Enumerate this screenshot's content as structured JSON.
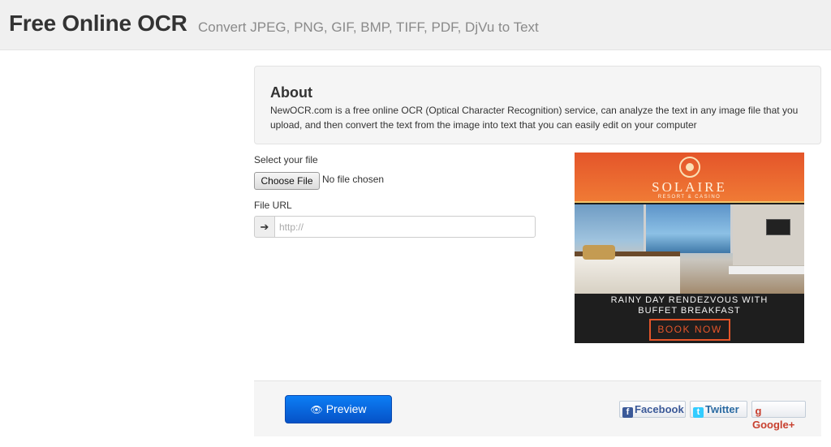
{
  "header": {
    "title": "Free Online OCR",
    "subtitle": "Convert JPEG, PNG, GIF, BMP, TIFF, PDF, DjVu to Text"
  },
  "about": {
    "heading": "About",
    "text": "NewOCR.com is a free online OCR (Optical Character Recognition) service, can analyze the text in any image file that you upload, and then convert the text from the image into text that you can easily edit on your computer"
  },
  "upload": {
    "select_label": "Select your file",
    "choose_button": "Choose File",
    "no_file_text": "No file chosen",
    "url_label": "File URL",
    "url_addon_icon": "arrow-right-icon",
    "url_addon_glyph": "➔",
    "url_placeholder": "http://",
    "url_value": ""
  },
  "ad": {
    "brand": "SOLAIRE",
    "brand_sub": "RESORT & CASINO",
    "headline_line1": "RAINY DAY RENDEZVOUS WITH",
    "headline_line2": "BUFFET BREAKFAST",
    "cta": "BOOK NOW"
  },
  "footer": {
    "preview_label": "Preview",
    "preview_icon": "eye-icon",
    "social": {
      "facebook": "Facebook",
      "twitter": "Twitter",
      "google": "Google+"
    }
  },
  "colors": {
    "header_bg": "#f0f0f0",
    "primary_button": "#0a66dd",
    "ad_orange": "#e4552a",
    "facebook": "#3b5998",
    "twitter": "#33ccff",
    "google": "#c8402f"
  }
}
